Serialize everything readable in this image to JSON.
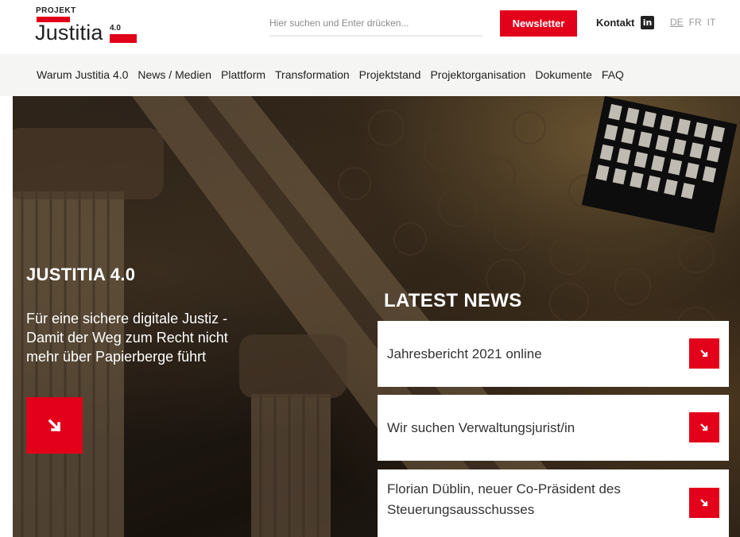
{
  "header": {
    "logo": {
      "projekt": "PROJEKT",
      "word": "Justitia",
      "version": "4.0"
    },
    "search_placeholder": "Hier suchen und Enter drücken...",
    "newsletter_label": "Newsletter",
    "kontakt_label": "Kontakt",
    "linkedin_icon": "linkedin-icon",
    "languages": [
      {
        "code": "DE",
        "active": true
      },
      {
        "code": "FR",
        "active": false
      },
      {
        "code": "IT",
        "active": false
      }
    ]
  },
  "nav": {
    "items": [
      "Warum Justitia 4.0",
      "News / Medien",
      "Plattform",
      "Transformation",
      "Projektstand",
      "Projektorganisation",
      "Dokumente",
      "FAQ"
    ]
  },
  "hero": {
    "title": "JUSTITIA 4.0",
    "subtitle": "Für eine sichere digitale Justiz - Damit der Weg zum Recht nicht mehr über Papierberge führt",
    "cta_icon": "arrow-down-right-icon"
  },
  "news": {
    "title": "LATEST NEWS",
    "items": [
      {
        "label": "Jahresbericht 2021 online"
      },
      {
        "label": "Wir suchen Verwaltungsjurist/in"
      },
      {
        "label": "Florian Düblin, neuer Co-Präsident des Steuerungsausschusses"
      }
    ]
  },
  "colors": {
    "accent": "#e2001a",
    "nav_bg": "#f5f5f3"
  }
}
